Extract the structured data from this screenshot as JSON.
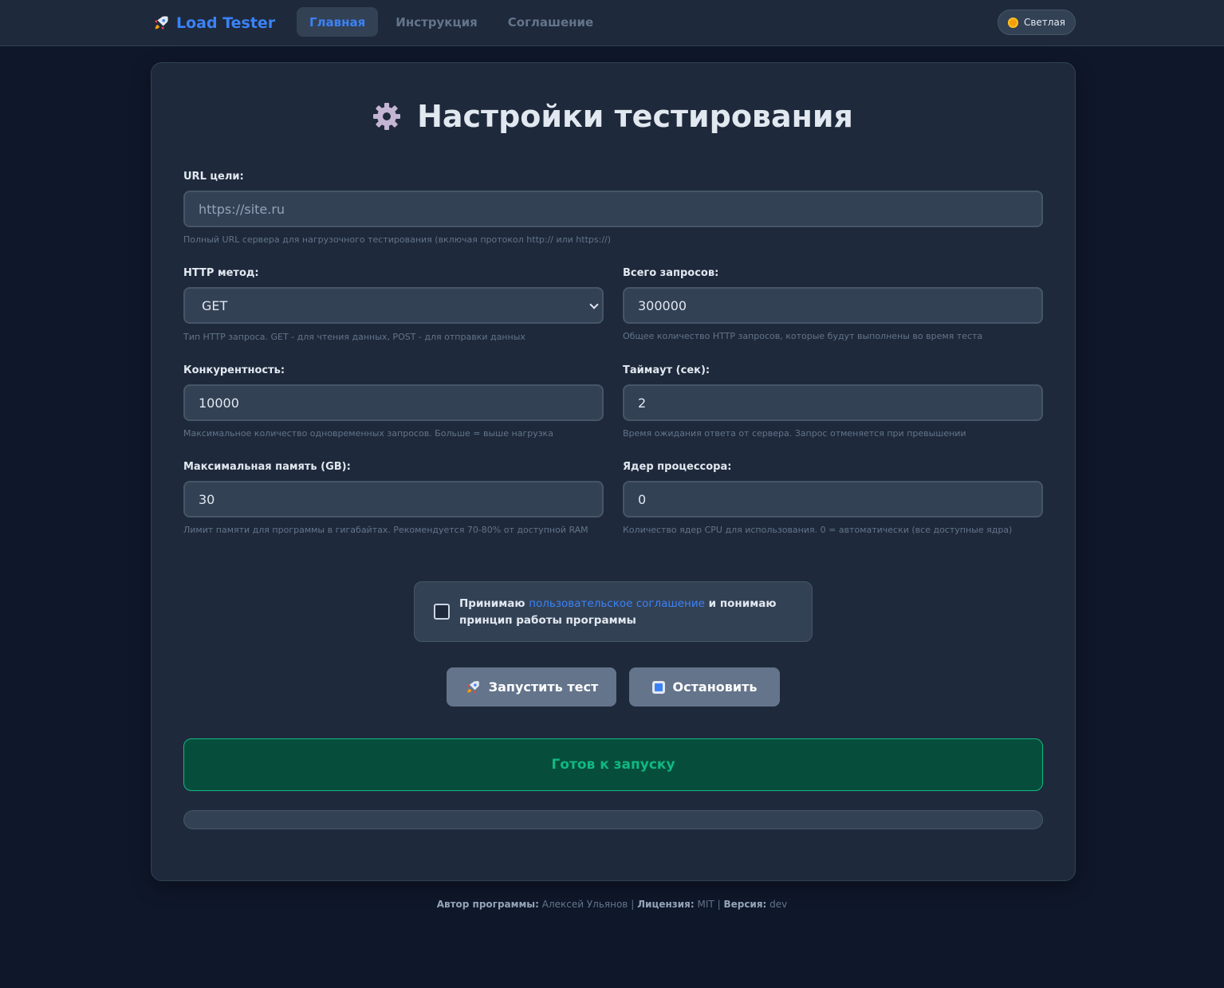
{
  "header": {
    "brand": "Load Tester",
    "nav": [
      {
        "label": "Главная",
        "active": true
      },
      {
        "label": "Инструкция",
        "active": false
      },
      {
        "label": "Соглашение",
        "active": false
      }
    ],
    "theme_label": "Светлая"
  },
  "main": {
    "title": "Настройки тестирования",
    "url": {
      "label": "URL цели:",
      "value": "",
      "placeholder": "https://site.ru",
      "hint": "Полный URL сервера для нагрузочного тестирования (включая протокол http:// или https://)"
    },
    "method": {
      "label": "HTTP метод:",
      "value": "GET",
      "hint": "Тип HTTP запроса. GET - для чтения данных, POST - для отправки данных"
    },
    "total_requests": {
      "label": "Всего запросов:",
      "value": "300000",
      "hint": "Общее количество HTTP запросов, которые будут выполнены во время теста"
    },
    "concurrency": {
      "label": "Конкурентность:",
      "value": "10000",
      "hint": "Максимальное количество одновременных запросов. Больше = выше нагрузка"
    },
    "timeout": {
      "label": "Таймаут (сек):",
      "value": "2",
      "hint": "Время ожидания ответа от сервера. Запрос отменяется при превышении"
    },
    "memory": {
      "label": "Максимальная память (GB):",
      "value": "30",
      "hint": "Лимит памяти для программы в гигабайтах. Рекомендуется 70-80% от доступной RAM"
    },
    "cpu": {
      "label": "Ядер процессора:",
      "value": "0",
      "hint": "Количество ядер CPU для использования. 0 = автоматически (все доступные ядра)"
    },
    "agreement": {
      "checked": false,
      "before": "Принимаю ",
      "link": "пользовательское соглашение",
      "after": " и понимаю принцип работы программы"
    },
    "buttons": {
      "start": "Запустить тест",
      "stop": "Остановить"
    },
    "status": "Готов к запуску",
    "progress": 0
  },
  "footer": {
    "author_label": "Автор программы:",
    "author": "Алексей Ульянов",
    "sep": "|",
    "license_label": "Лицензия:",
    "license": "MIT",
    "version_label": "Версия:",
    "version": "dev"
  },
  "colors": {
    "accent": "#3b82f6",
    "success": "#10b981",
    "background": "#0f172a",
    "card": "#1e293b"
  }
}
